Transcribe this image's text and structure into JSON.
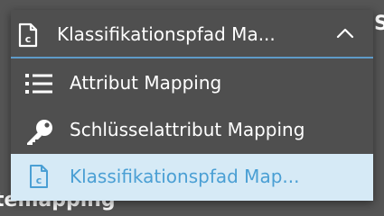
{
  "background": {
    "section_text": "temapping",
    "edge_glyph": "S"
  },
  "dropdown": {
    "selected_label": "Klassifikationspfad Ma...",
    "selected_icon": "document-c-icon",
    "toggle_icon": "chevron-up-icon",
    "accent_color": "#5e9bc8",
    "items": [
      {
        "label": "Attribut Mapping",
        "icon": "list-icon",
        "selected": false
      },
      {
        "label": "Schlüsselattribut Mapping",
        "icon": "key-icon",
        "selected": false
      },
      {
        "label": "Klassifikationspfad Map...",
        "icon": "document-c-icon",
        "selected": true
      }
    ],
    "selected_bg": "#d6eaf6",
    "selected_text_color": "#4a9fd4"
  }
}
